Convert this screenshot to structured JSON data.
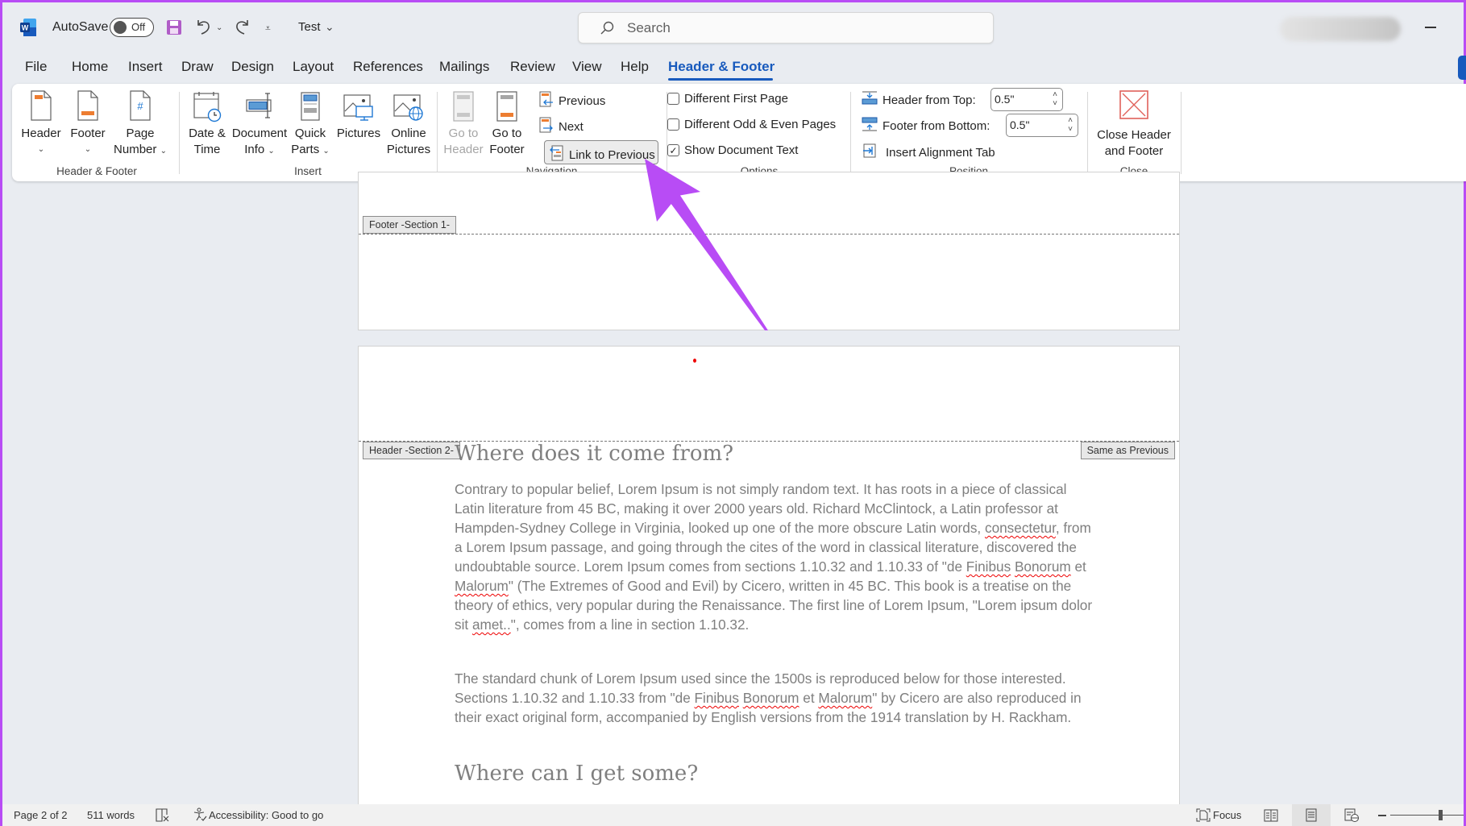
{
  "titlebar": {
    "app_icon": "word-icon",
    "autosave_label": "AutoSave",
    "autosave_state": "Off",
    "doc_name": "Test",
    "search_placeholder": "Search",
    "minimize_icon": "minimize-icon"
  },
  "tabs": [
    {
      "label": "File"
    },
    {
      "label": "Home"
    },
    {
      "label": "Insert"
    },
    {
      "label": "Draw"
    },
    {
      "label": "Design"
    },
    {
      "label": "Layout"
    },
    {
      "label": "References"
    },
    {
      "label": "Mailings"
    },
    {
      "label": "Review"
    },
    {
      "label": "View"
    },
    {
      "label": "Help"
    },
    {
      "label": "Header & Footer",
      "active": true
    }
  ],
  "ribbon": {
    "groups": {
      "header_footer": "Header & Footer",
      "insert": "Insert",
      "navigation": "Navigation",
      "options": "Options",
      "position": "Position",
      "close": "Close"
    },
    "header_btn": "Header",
    "footer_btn": "Footer",
    "page_number_1": "Page",
    "page_number_2": "Number",
    "date_time_1": "Date &",
    "date_time_2": "Time",
    "doc_info_1": "Document",
    "doc_info_2": "Info",
    "quick_parts_1": "Quick",
    "quick_parts_2": "Parts",
    "pictures": "Pictures",
    "online_pictures_1": "Online",
    "online_pictures_2": "Pictures",
    "goto_header_1": "Go to",
    "goto_header_2": "Header",
    "goto_footer_1": "Go to",
    "goto_footer_2": "Footer",
    "previous": "Previous",
    "next": "Next",
    "link_to_previous": "Link to Previous",
    "different_first_page": {
      "label": "Different First Page",
      "checked": false
    },
    "different_odd_even": {
      "label": "Different Odd & Even Pages",
      "checked": false
    },
    "show_document_text": {
      "label": "Show Document Text",
      "checked": true
    },
    "header_from_top": {
      "label": "Header from Top:",
      "value": "0.5\""
    },
    "footer_from_bottom": {
      "label": "Footer from Bottom:",
      "value": "0.5\""
    },
    "insert_alignment_tab": "Insert Alignment Tab",
    "close_1": "Close Header",
    "close_2": "and Footer"
  },
  "document": {
    "footer_tag_page1": "Footer -Section 1-",
    "header_tag_page2": "Header -Section 2-",
    "same_as_previous": "Same as Previous",
    "heading1": "Where does it come from?",
    "para1": [
      {
        "t": "Contrary to popular belief, Lorem Ipsum is not simply random text. It has roots in a piece of classical Latin literature from 45 BC, making it over 2000 years old. Richard McClintock, a Latin professor at Hampden-Sydney College in Virginia, looked up one of the more obscure Latin words, "
      },
      {
        "t": "consectetur",
        "sq": true
      },
      {
        "t": ", from a Lorem Ipsum passage, and going through the cites of the word in classical literature, discovered the undoubtable source. Lorem Ipsum comes from sections 1.10.32 and 1.10.33 of \"de "
      },
      {
        "t": "Finibus",
        "sq": true
      },
      {
        "t": " "
      },
      {
        "t": "Bonorum",
        "sq": true
      },
      {
        "t": " et "
      },
      {
        "t": "Malorum",
        "sq": true
      },
      {
        "t": "\" (The Extremes of Good and Evil) by Cicero, written in 45 BC. This book is a treatise on the theory of ethics, very popular during the Renaissance. The first line of Lorem Ipsum, \"Lorem ipsum dolor sit "
      },
      {
        "t": "amet..",
        "sq": true
      },
      {
        "t": "\", comes from a line in section 1.10.32."
      }
    ],
    "para2": [
      {
        "t": "The standard chunk of Lorem Ipsum used since the 1500s is reproduced below for those interested. Sections 1.10.32 and 1.10.33 from \"de "
      },
      {
        "t": "Finibus",
        "sq": true
      },
      {
        "t": " "
      },
      {
        "t": "Bonorum",
        "sq": true
      },
      {
        "t": " et "
      },
      {
        "t": "Malorum",
        "sq": true
      },
      {
        "t": "\" by Cicero are also reproduced in their exact original form, accompanied by English versions from the 1914 translation by H. Rackham."
      }
    ],
    "heading2": "Where can I get some?"
  },
  "statusbar": {
    "page": "Page 2 of 2",
    "words": "511 words",
    "accessibility": "Accessibility: Good to go",
    "focus": "Focus"
  },
  "annotation": {
    "arrow_color": "#b84cf5",
    "points_to": "Link to Previous"
  },
  "colors": {
    "accent": "#185abd",
    "annotation": "#b84cf5"
  }
}
